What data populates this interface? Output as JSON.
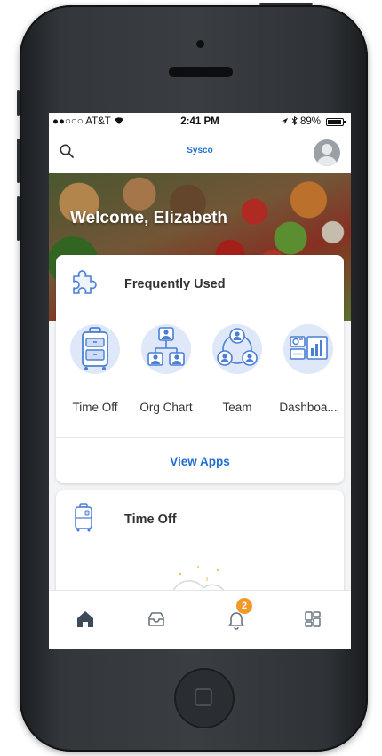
{
  "status_bar": {
    "carrier": "●●○○○ AT&T",
    "time": "2:41 PM",
    "battery": "89%"
  },
  "app_bar": {
    "brand": "Sysco"
  },
  "hero": {
    "welcome": "Welcome, Elizabeth"
  },
  "frequently_used": {
    "title": "Frequently Used",
    "apps": [
      {
        "label": "Time Off",
        "icon": "suitcase-icon"
      },
      {
        "label": "Org Chart",
        "icon": "org-chart-icon"
      },
      {
        "label": "Team",
        "icon": "team-icon"
      },
      {
        "label": "Dashboa...",
        "icon": "dashboard-icon"
      }
    ],
    "view_apps": "View Apps"
  },
  "time_off_card": {
    "title": "Time Off"
  },
  "tab_bar": {
    "items": [
      {
        "name": "home-icon"
      },
      {
        "name": "inbox-icon"
      },
      {
        "name": "notifications-icon",
        "badge": "2"
      },
      {
        "name": "apps-grid-icon"
      }
    ]
  },
  "colors": {
    "accent_blue": "#1f6fcf",
    "icon_blue": "#4b7fd6",
    "badge_orange": "#f29a29"
  }
}
